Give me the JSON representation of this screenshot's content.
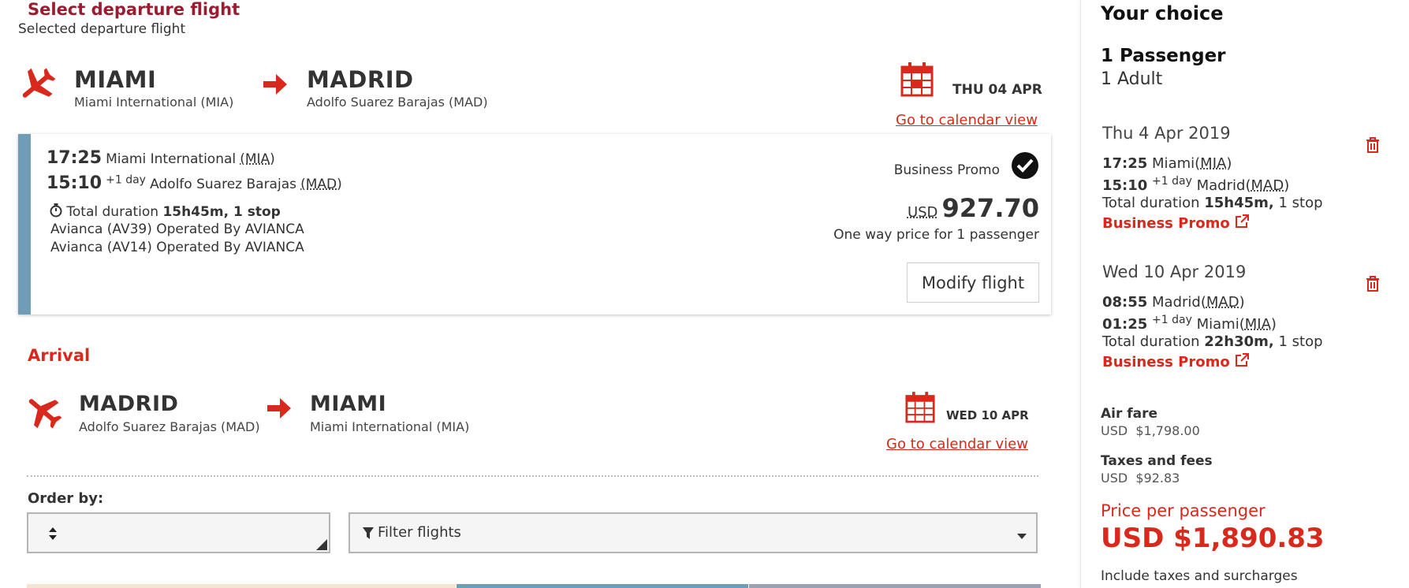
{
  "departure": {
    "heading": "Select departure flight",
    "subheading": "Selected departure flight",
    "from_city": "MIAMI",
    "from_airport": "Miami International (MIA)",
    "to_city": "MADRID",
    "to_airport": "Adolfo Suarez Barajas (MAD)",
    "date": "THU 04 APR",
    "calendar_link": "Go to calendar view"
  },
  "selected_flight": {
    "dep_time": "17:25",
    "dep_airport": "Miami International",
    "dep_code": "(MIA)",
    "arr_time": "15:10",
    "arr_day_offset": "+1 day",
    "arr_airport": "Adolfo Suarez Barajas",
    "arr_code": "(MAD)",
    "duration_label": "Total duration",
    "duration_value": "15h45m, 1 stop",
    "leg1": "Avianca (AV39) Operated By AVIANCA",
    "leg2": "Avianca (AV14) Operated By AVIANCA",
    "fare_name": "Business Promo",
    "currency": "USD",
    "price": "927.70",
    "price_note": "One way price for 1 passenger",
    "modify_label": "Modify flight"
  },
  "arrival": {
    "heading": "Arrival",
    "from_city": "MADRID",
    "from_airport": "Adolfo Suarez Barajas (MAD)",
    "to_city": "MIAMI",
    "to_airport": "Miami International (MIA)",
    "date": "WED 10 APR",
    "calendar_link": "Go to calendar view"
  },
  "controls": {
    "order_label": "Order by:",
    "order_value": "",
    "filter_label": "Filter flights"
  },
  "sidebar": {
    "title": "Your choice",
    "passengers": "1 Passenger",
    "passenger_type": "1 Adult",
    "outbound": {
      "date": "Thu 4 Apr 2019",
      "dep_time": "17:25",
      "dep_city": "Miami",
      "dep_code": "MIA",
      "arr_time": "15:10",
      "arr_offset": "+1 day",
      "arr_city": "Madrid",
      "arr_code": "MAD",
      "duration_label": "Total duration",
      "duration_value": "15h45m,",
      "stops": "1 stop",
      "fare": "Business Promo"
    },
    "inbound": {
      "date": "Wed 10 Apr 2019",
      "dep_time": "08:55",
      "dep_city": "Madrid",
      "dep_code": "MAD",
      "arr_time": "01:25",
      "arr_offset": "+1 day",
      "arr_city": "Miami",
      "arr_code": "MIA",
      "duration_label": "Total duration",
      "duration_value": "22h30m,",
      "stops": "1 stop",
      "fare": "Business Promo"
    },
    "air_fare_label": "Air fare",
    "air_fare_currency": "USD",
    "air_fare_value": "$1,798.00",
    "taxes_label": "Taxes and fees",
    "taxes_currency": "USD",
    "taxes_value": "$92.83",
    "price_per_label": "Price per passenger",
    "total_price": "USD $1,890.83",
    "include_note": "Include taxes and surcharges"
  },
  "colors": {
    "accent_red": "#d9291c",
    "heading_maroon": "#9b1b30",
    "card_stripe": "#6f9db8",
    "tab_peach": "#f6e4d2",
    "tab_blue": "#6f9db8",
    "tab_grey": "#9aa3b5"
  }
}
